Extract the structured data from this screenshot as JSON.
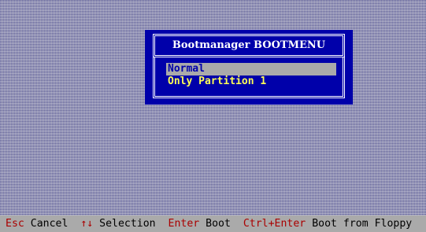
{
  "dialog": {
    "title": "Bootmanager BOOTMENU",
    "options": [
      {
        "label": "Normal",
        "selected": true
      },
      {
        "label": "Only Partition 1",
        "selected": false
      }
    ]
  },
  "statusbar": {
    "items": [
      {
        "key": "Esc",
        "action": "Cancel"
      },
      {
        "key": "↑↓",
        "action": "Selection"
      },
      {
        "key": "Enter",
        "action": "Boot"
      },
      {
        "key": "Ctrl+Enter",
        "action": "Boot from Floppy"
      }
    ]
  },
  "colors": {
    "dialog_bg": "#0000aa",
    "border": "#ffffff",
    "option_text": "#ffff55",
    "selected_bg": "#aaaaaa",
    "status_bg": "#aaaaaa",
    "key_text": "#aa0000"
  }
}
